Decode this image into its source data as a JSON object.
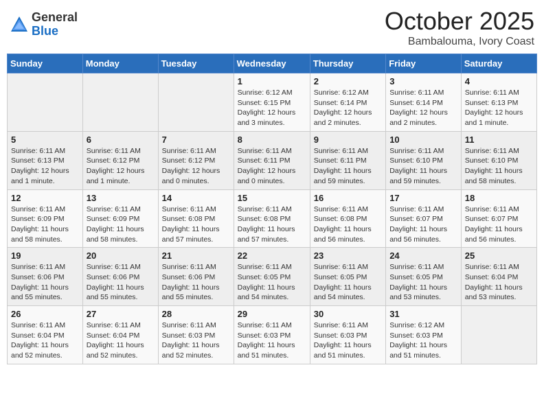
{
  "logo": {
    "general": "General",
    "blue": "Blue"
  },
  "title": "October 2025",
  "location": "Bambalouma, Ivory Coast",
  "weekdays": [
    "Sunday",
    "Monday",
    "Tuesday",
    "Wednesday",
    "Thursday",
    "Friday",
    "Saturday"
  ],
  "weeks": [
    [
      {
        "day": "",
        "info": ""
      },
      {
        "day": "",
        "info": ""
      },
      {
        "day": "",
        "info": ""
      },
      {
        "day": "1",
        "info": "Sunrise: 6:12 AM\nSunset: 6:15 PM\nDaylight: 12 hours and 3 minutes."
      },
      {
        "day": "2",
        "info": "Sunrise: 6:12 AM\nSunset: 6:14 PM\nDaylight: 12 hours and 2 minutes."
      },
      {
        "day": "3",
        "info": "Sunrise: 6:11 AM\nSunset: 6:14 PM\nDaylight: 12 hours and 2 minutes."
      },
      {
        "day": "4",
        "info": "Sunrise: 6:11 AM\nSunset: 6:13 PM\nDaylight: 12 hours and 1 minute."
      }
    ],
    [
      {
        "day": "5",
        "info": "Sunrise: 6:11 AM\nSunset: 6:13 PM\nDaylight: 12 hours and 1 minute."
      },
      {
        "day": "6",
        "info": "Sunrise: 6:11 AM\nSunset: 6:12 PM\nDaylight: 12 hours and 1 minute."
      },
      {
        "day": "7",
        "info": "Sunrise: 6:11 AM\nSunset: 6:12 PM\nDaylight: 12 hours and 0 minutes."
      },
      {
        "day": "8",
        "info": "Sunrise: 6:11 AM\nSunset: 6:11 PM\nDaylight: 12 hours and 0 minutes."
      },
      {
        "day": "9",
        "info": "Sunrise: 6:11 AM\nSunset: 6:11 PM\nDaylight: 11 hours and 59 minutes."
      },
      {
        "day": "10",
        "info": "Sunrise: 6:11 AM\nSunset: 6:10 PM\nDaylight: 11 hours and 59 minutes."
      },
      {
        "day": "11",
        "info": "Sunrise: 6:11 AM\nSunset: 6:10 PM\nDaylight: 11 hours and 58 minutes."
      }
    ],
    [
      {
        "day": "12",
        "info": "Sunrise: 6:11 AM\nSunset: 6:09 PM\nDaylight: 11 hours and 58 minutes."
      },
      {
        "day": "13",
        "info": "Sunrise: 6:11 AM\nSunset: 6:09 PM\nDaylight: 11 hours and 58 minutes."
      },
      {
        "day": "14",
        "info": "Sunrise: 6:11 AM\nSunset: 6:08 PM\nDaylight: 11 hours and 57 minutes."
      },
      {
        "day": "15",
        "info": "Sunrise: 6:11 AM\nSunset: 6:08 PM\nDaylight: 11 hours and 57 minutes."
      },
      {
        "day": "16",
        "info": "Sunrise: 6:11 AM\nSunset: 6:08 PM\nDaylight: 11 hours and 56 minutes."
      },
      {
        "day": "17",
        "info": "Sunrise: 6:11 AM\nSunset: 6:07 PM\nDaylight: 11 hours and 56 minutes."
      },
      {
        "day": "18",
        "info": "Sunrise: 6:11 AM\nSunset: 6:07 PM\nDaylight: 11 hours and 56 minutes."
      }
    ],
    [
      {
        "day": "19",
        "info": "Sunrise: 6:11 AM\nSunset: 6:06 PM\nDaylight: 11 hours and 55 minutes."
      },
      {
        "day": "20",
        "info": "Sunrise: 6:11 AM\nSunset: 6:06 PM\nDaylight: 11 hours and 55 minutes."
      },
      {
        "day": "21",
        "info": "Sunrise: 6:11 AM\nSunset: 6:06 PM\nDaylight: 11 hours and 55 minutes."
      },
      {
        "day": "22",
        "info": "Sunrise: 6:11 AM\nSunset: 6:05 PM\nDaylight: 11 hours and 54 minutes."
      },
      {
        "day": "23",
        "info": "Sunrise: 6:11 AM\nSunset: 6:05 PM\nDaylight: 11 hours and 54 minutes."
      },
      {
        "day": "24",
        "info": "Sunrise: 6:11 AM\nSunset: 6:05 PM\nDaylight: 11 hours and 53 minutes."
      },
      {
        "day": "25",
        "info": "Sunrise: 6:11 AM\nSunset: 6:04 PM\nDaylight: 11 hours and 53 minutes."
      }
    ],
    [
      {
        "day": "26",
        "info": "Sunrise: 6:11 AM\nSunset: 6:04 PM\nDaylight: 11 hours and 52 minutes."
      },
      {
        "day": "27",
        "info": "Sunrise: 6:11 AM\nSunset: 6:04 PM\nDaylight: 11 hours and 52 minutes."
      },
      {
        "day": "28",
        "info": "Sunrise: 6:11 AM\nSunset: 6:03 PM\nDaylight: 11 hours and 52 minutes."
      },
      {
        "day": "29",
        "info": "Sunrise: 6:11 AM\nSunset: 6:03 PM\nDaylight: 11 hours and 51 minutes."
      },
      {
        "day": "30",
        "info": "Sunrise: 6:11 AM\nSunset: 6:03 PM\nDaylight: 11 hours and 51 minutes."
      },
      {
        "day": "31",
        "info": "Sunrise: 6:12 AM\nSunset: 6:03 PM\nDaylight: 11 hours and 51 minutes."
      },
      {
        "day": "",
        "info": ""
      }
    ]
  ]
}
